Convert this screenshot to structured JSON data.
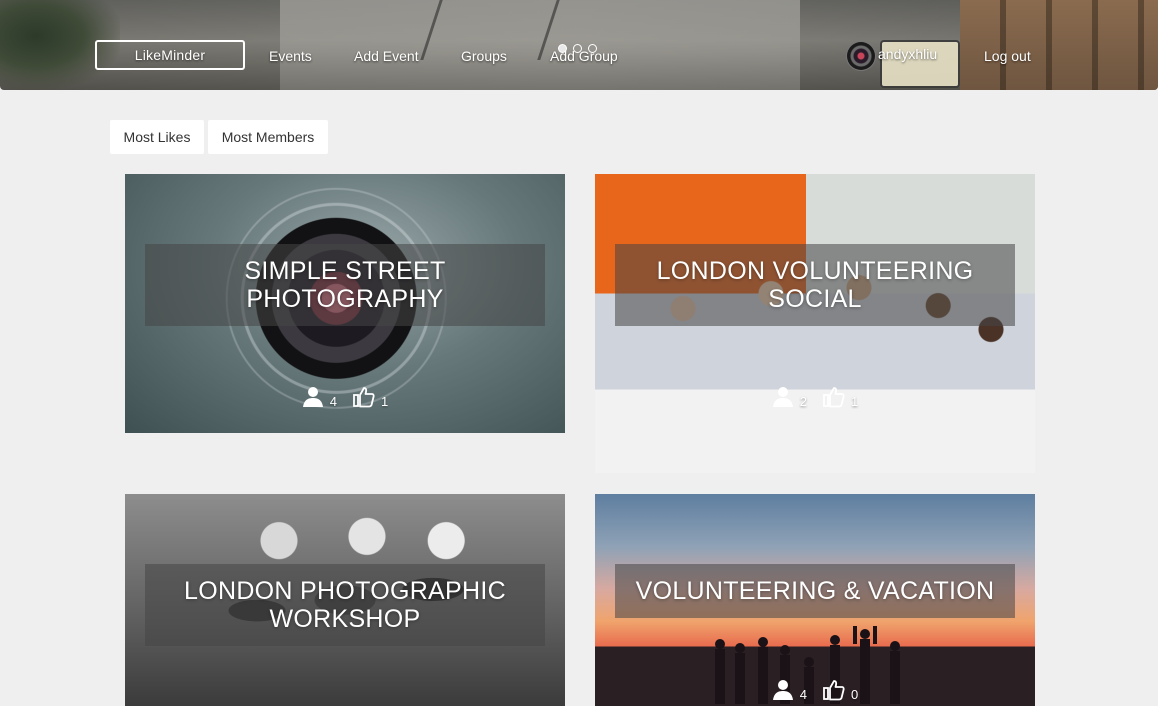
{
  "header": {
    "brand": "LikeMinder",
    "nav": [
      "Events",
      "Add Event",
      "Groups",
      "Add Group"
    ],
    "carousel_dots": 3,
    "carousel_active": 0,
    "user": {
      "name": "andyxhliu",
      "avatar_icon": "camera-lens-avatar"
    },
    "logout": "Log out"
  },
  "sort": {
    "most_likes": "Most Likes",
    "most_members": "Most Members"
  },
  "groups": [
    {
      "title": "SIMPLE STREET PHOTOGRAPHY",
      "members": "4",
      "likes": "1"
    },
    {
      "title": "LONDON VOLUNTEERING SOCIAL",
      "members": "2",
      "likes": "1"
    },
    {
      "title": "LONDON PHOTOGRAPHIC WORKSHOP",
      "members": "",
      "likes": ""
    },
    {
      "title": "VOLUNTEERING & VACATION",
      "members": "4",
      "likes": "0"
    }
  ],
  "icons": {
    "members": "user-icon",
    "likes": "thumbs-up-icon"
  },
  "colors": {
    "title_overlay": "#464646",
    "page_bg": "#efefef",
    "button_bg": "#ffffff"
  }
}
